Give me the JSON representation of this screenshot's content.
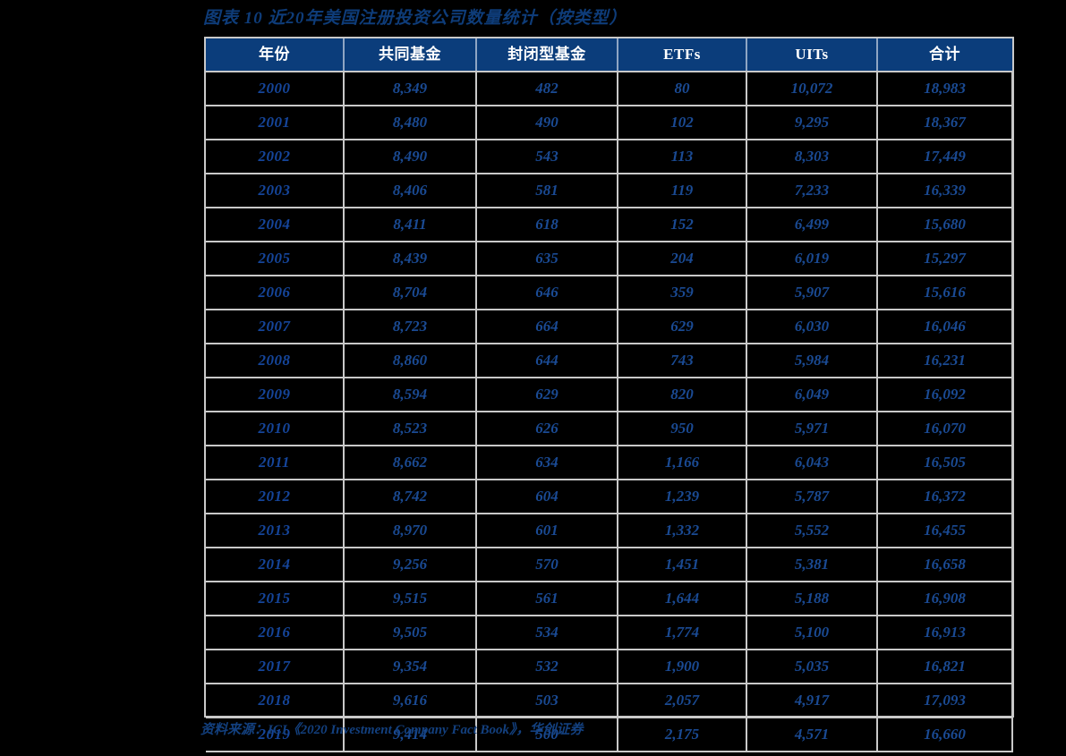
{
  "title": "图表 10   近20年美国注册投资公司数量统计（按类型）",
  "source_note": "资料来源：ICI《2020 Investment Company Fact Book》，华创证券",
  "colors": {
    "header_background": "#0b3d7b",
    "header_text": "#ffffff",
    "body_text": "#1a4a93",
    "title_text": "#0e3c79",
    "border": "#c9c9c9",
    "page_background": "#000000"
  },
  "chart_data": {
    "type": "table",
    "title": "图表 10   近20年美国注册投资公司数量统计（按类型）",
    "columns": [
      "年份",
      "共同基金",
      "封闭型基金",
      "ETFs",
      "UITs",
      "合计"
    ],
    "rows": [
      [
        "2000",
        "8,349",
        "482",
        "80",
        "10,072",
        "18,983"
      ],
      [
        "2001",
        "8,480",
        "490",
        "102",
        "9,295",
        "18,367"
      ],
      [
        "2002",
        "8,490",
        "543",
        "113",
        "8,303",
        "17,449"
      ],
      [
        "2003",
        "8,406",
        "581",
        "119",
        "7,233",
        "16,339"
      ],
      [
        "2004",
        "8,411",
        "618",
        "152",
        "6,499",
        "15,680"
      ],
      [
        "2005",
        "8,439",
        "635",
        "204",
        "6,019",
        "15,297"
      ],
      [
        "2006",
        "8,704",
        "646",
        "359",
        "5,907",
        "15,616"
      ],
      [
        "2007",
        "8,723",
        "664",
        "629",
        "6,030",
        "16,046"
      ],
      [
        "2008",
        "8,860",
        "644",
        "743",
        "5,984",
        "16,231"
      ],
      [
        "2009",
        "8,594",
        "629",
        "820",
        "6,049",
        "16,092"
      ],
      [
        "2010",
        "8,523",
        "626",
        "950",
        "5,971",
        "16,070"
      ],
      [
        "2011",
        "8,662",
        "634",
        "1,166",
        "6,043",
        "16,505"
      ],
      [
        "2012",
        "8,742",
        "604",
        "1,239",
        "5,787",
        "16,372"
      ],
      [
        "2013",
        "8,970",
        "601",
        "1,332",
        "5,552",
        "16,455"
      ],
      [
        "2014",
        "9,256",
        "570",
        "1,451",
        "5,381",
        "16,658"
      ],
      [
        "2015",
        "9,515",
        "561",
        "1,644",
        "5,188",
        "16,908"
      ],
      [
        "2016",
        "9,505",
        "534",
        "1,774",
        "5,100",
        "16,913"
      ],
      [
        "2017",
        "9,354",
        "532",
        "1,900",
        "5,035",
        "16,821"
      ],
      [
        "2018",
        "9,616",
        "503",
        "2,057",
        "4,917",
        "17,093"
      ],
      [
        "2019",
        "9,414",
        "500",
        "2,175",
        "4,571",
        "16,660"
      ]
    ],
    "series": [
      {
        "name": "共同基金",
        "values": [
          8349,
          8480,
          8490,
          8406,
          8411,
          8439,
          8704,
          8723,
          8860,
          8594,
          8523,
          8662,
          8742,
          8970,
          9256,
          9515,
          9505,
          9354,
          9616,
          9414
        ]
      },
      {
        "name": "封闭型基金",
        "values": [
          482,
          490,
          543,
          581,
          618,
          635,
          646,
          664,
          644,
          629,
          626,
          634,
          604,
          601,
          570,
          561,
          534,
          532,
          503,
          500
        ]
      },
      {
        "name": "ETFs",
        "values": [
          80,
          102,
          113,
          119,
          152,
          204,
          359,
          629,
          743,
          820,
          950,
          1166,
          1239,
          1332,
          1451,
          1644,
          1774,
          1900,
          2057,
          2175
        ]
      },
      {
        "name": "UITs",
        "values": [
          10072,
          9295,
          8303,
          7233,
          6499,
          6019,
          5907,
          6030,
          5984,
          6049,
          5971,
          6043,
          5787,
          5552,
          5381,
          5188,
          5100,
          5035,
          4917,
          4571
        ]
      },
      {
        "name": "合计",
        "values": [
          18983,
          18367,
          17449,
          16339,
          15680,
          15297,
          15616,
          16046,
          16231,
          16092,
          16070,
          16505,
          16372,
          16455,
          16658,
          16908,
          16913,
          16821,
          17093,
          16660
        ]
      }
    ],
    "categories": [
      "2000",
      "2001",
      "2002",
      "2003",
      "2004",
      "2005",
      "2006",
      "2007",
      "2008",
      "2009",
      "2010",
      "2011",
      "2012",
      "2013",
      "2014",
      "2015",
      "2016",
      "2017",
      "2018",
      "2019"
    ],
    "xlabel": "年份",
    "ylabel": ""
  }
}
